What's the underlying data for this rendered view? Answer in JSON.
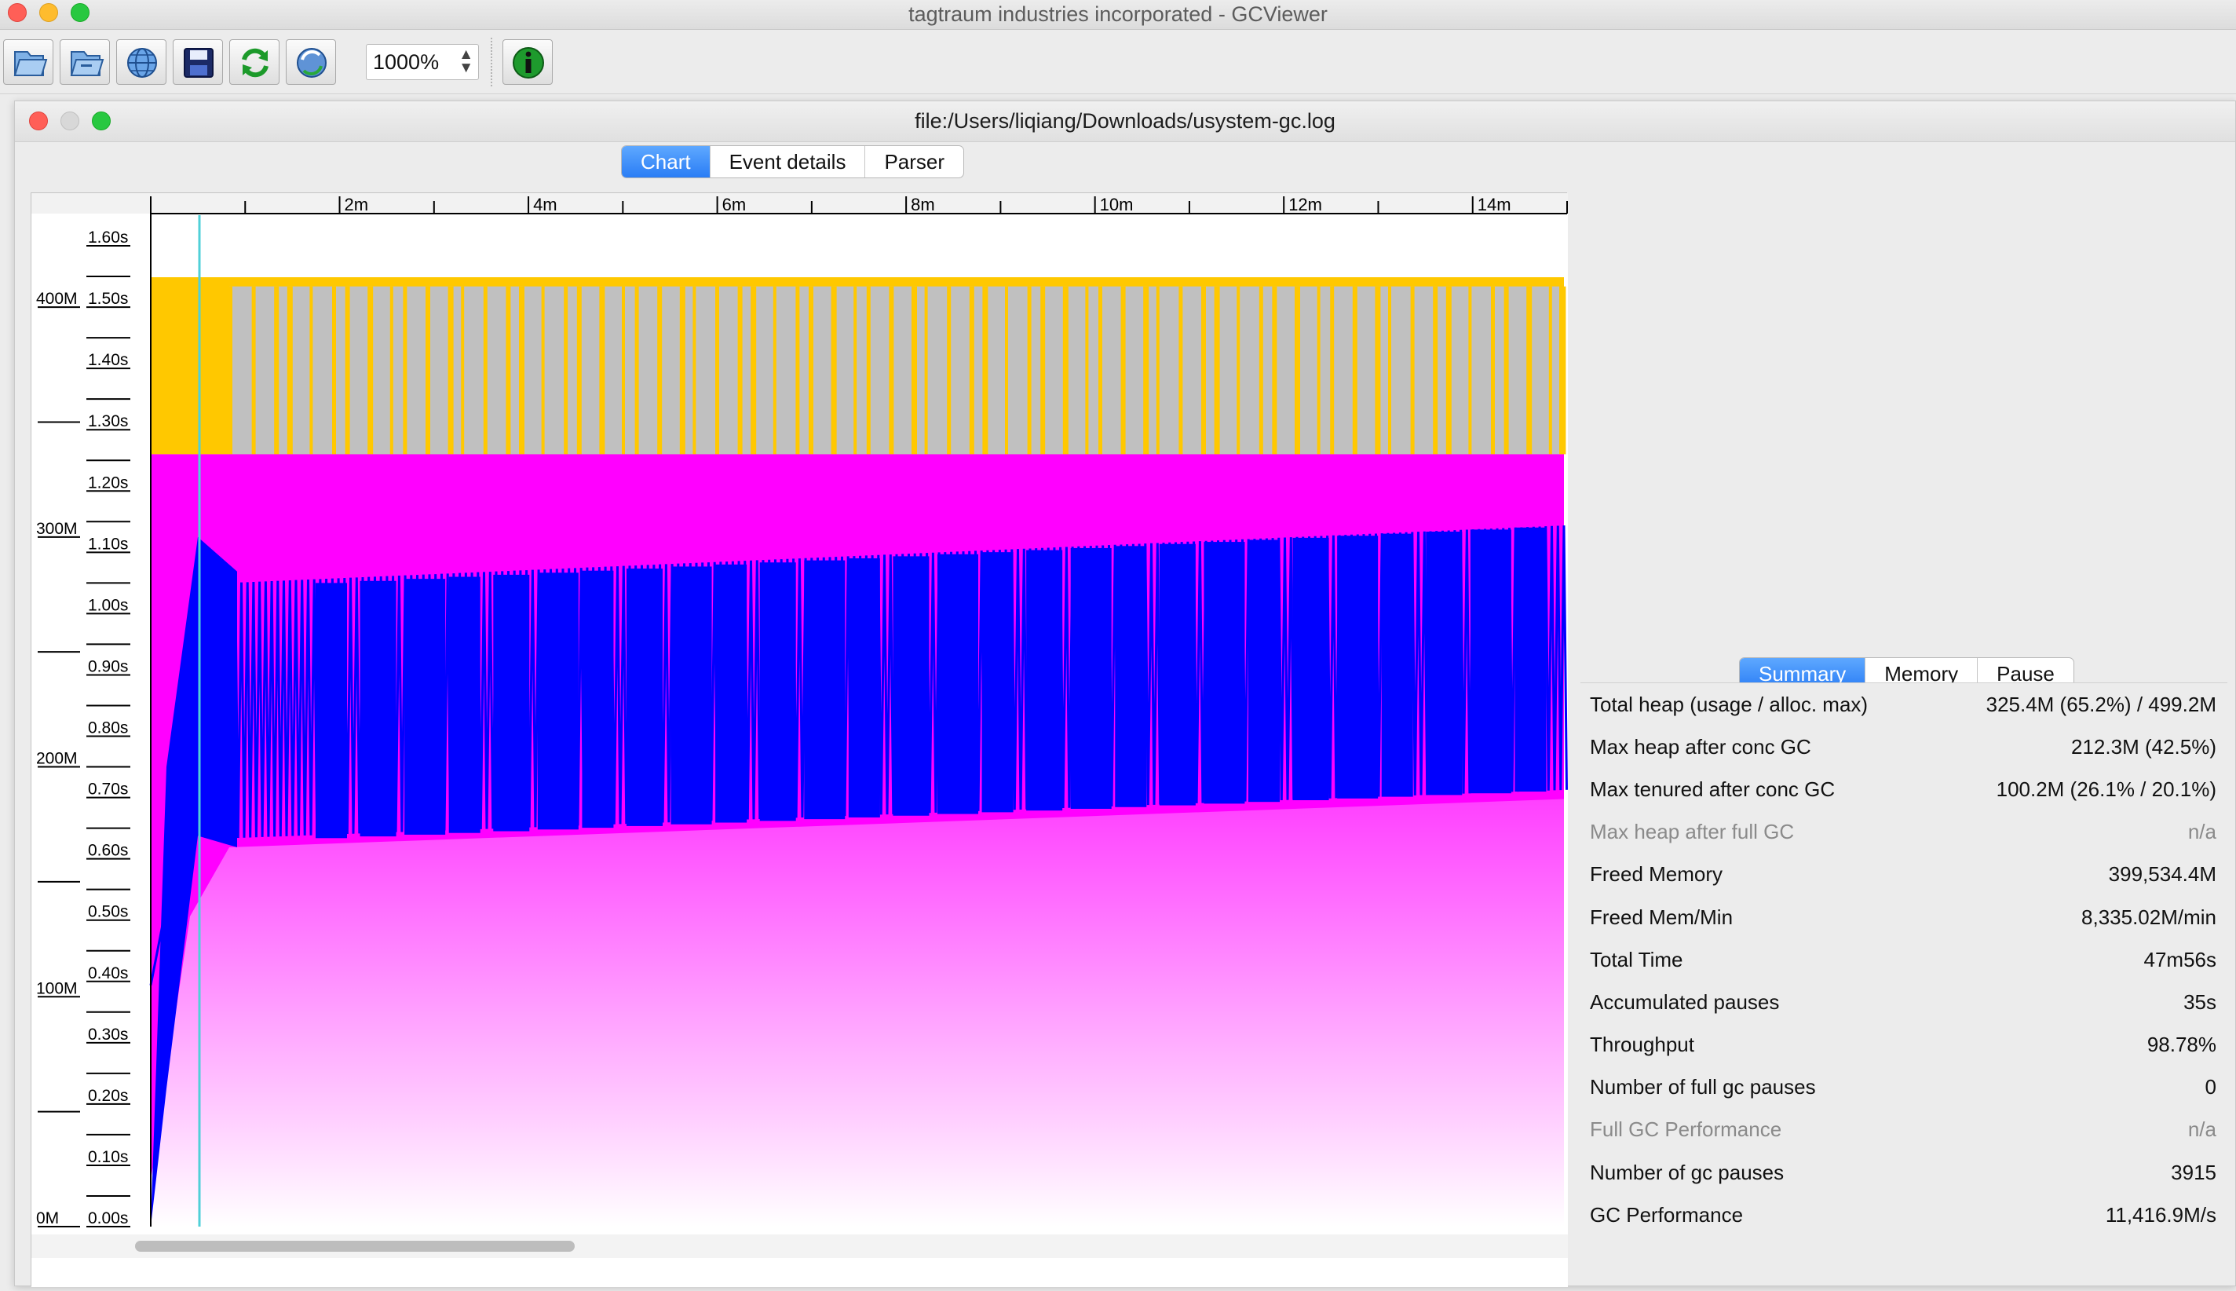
{
  "window": {
    "title": "tagtraum industries incorporated - GCViewer"
  },
  "toolbar": {
    "buttons": [
      {
        "name": "open-file-button",
        "icon": "open-file-icon"
      },
      {
        "name": "open-series-button",
        "icon": "open-series-icon"
      },
      {
        "name": "open-url-button",
        "icon": "globe-icon"
      },
      {
        "name": "export-button",
        "icon": "save-disk-icon"
      },
      {
        "name": "refresh-button",
        "icon": "refresh-icon"
      },
      {
        "name": "watch-button",
        "icon": "watch-globe-icon"
      },
      {
        "name": "info-button",
        "icon": "info-icon"
      }
    ],
    "zoom_value": "1000%"
  },
  "document": {
    "title": "file:/Users/liqiang/Downloads/usystem-gc.log",
    "tabs": [
      "Chart",
      "Event details",
      "Parser"
    ],
    "active_tab": "Chart"
  },
  "chart_data": {
    "type": "area",
    "x_tick_labels": [
      "2m",
      "4m",
      "6m",
      "8m",
      "10m",
      "12m",
      "14m"
    ],
    "left_axis_labels": [
      "400M",
      "300M",
      "200M",
      "100M",
      "0M"
    ],
    "pause_axis_labels": [
      "1.60s",
      "1.50s",
      "1.40s",
      "1.30s",
      "1.20s",
      "1.10s",
      "1.00s",
      "0.90s",
      "0.80s",
      "0.70s",
      "0.60s",
      "0.50s",
      "0.40s",
      "0.30s",
      "0.20s",
      "0.10s",
      "0.00s"
    ],
    "xlim_minutes": [
      0,
      15
    ],
    "memory_ylim_mb": [
      0,
      440
    ],
    "series": [
      {
        "key": "total_heap",
        "color": "#ffc800",
        "level_mb": 413
      },
      {
        "key": "young_gen",
        "color": "#c0c0c0",
        "level_mb": 409
      },
      {
        "key": "tenured_gen",
        "color": "#ff00ff",
        "level_mb": 336
      },
      {
        "key": "used_heap",
        "color": "#0000ff",
        "start_mb": 280,
        "end_mb": 305
      },
      {
        "key": "used_tenured",
        "color": "#ff40ff",
        "start_mb": 165,
        "end_mb": 186
      }
    ],
    "marker_color": "#50d0d8",
    "legend": "none"
  },
  "summary": {
    "tabs": [
      "Summary",
      "Memory",
      "Pause"
    ],
    "active_tab": "Summary",
    "rows": [
      {
        "label": "Total heap (usage / alloc. max)",
        "value": "325.4M (65.2%) / 499.2M",
        "dim": false
      },
      {
        "label": "Max heap after conc GC",
        "value": "212.3M (42.5%)",
        "dim": false
      },
      {
        "label": "Max tenured after conc GC",
        "value": "100.2M (26.1% / 20.1%)",
        "dim": false
      },
      {
        "label": "Max heap after full GC",
        "value": "n/a",
        "dim": true
      },
      {
        "label": "Freed Memory",
        "value": "399,534.4M",
        "dim": false
      },
      {
        "label": "Freed Mem/Min",
        "value": "8,335.02M/min",
        "dim": false
      },
      {
        "label": "Total Time",
        "value": "47m56s",
        "dim": false
      },
      {
        "label": "Accumulated pauses",
        "value": "35s",
        "dim": false
      },
      {
        "label": "Throughput",
        "value": "98.78%",
        "dim": false
      },
      {
        "label": "Number of full gc pauses",
        "value": "0",
        "dim": false
      },
      {
        "label": "Full GC Performance",
        "value": "n/a",
        "dim": true
      },
      {
        "label": "Number of gc pauses",
        "value": "3915",
        "dim": false
      },
      {
        "label": "GC Performance",
        "value": "11,416.9M/s",
        "dim": false
      }
    ]
  }
}
